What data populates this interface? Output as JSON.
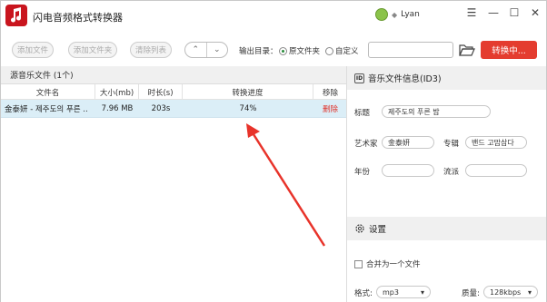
{
  "app": {
    "title": "闪电音频格式转换器"
  },
  "user": {
    "vip": "VIP",
    "name": "Lyan"
  },
  "window": {
    "minimize": "—",
    "restore": "☐",
    "close": "✕",
    "menu": "☰"
  },
  "toolbar": {
    "add_file": "添加文件",
    "add_folder": "添加文件夹",
    "clear_list": "清除列表",
    "up_arrow": "⌃",
    "down_arrow": "⌄",
    "output_dir_label": "输出目录：",
    "radio_source": "原文件夹",
    "radio_custom": "自定义",
    "output_path": "",
    "convert": "转换中..."
  },
  "source": {
    "header": "源音乐文件 (1个)",
    "columns": [
      "文件名",
      "大小(mb)",
      "时长(s)",
      "转换进度",
      "移除"
    ],
    "rows": [
      {
        "filename": "金泰妍 - 제주도의 푸른 ..",
        "size": "7.96 MB",
        "duration": "203s",
        "progress": "74%",
        "remove": "删除"
      }
    ]
  },
  "info": {
    "header": "音乐文件信息(ID3)",
    "title_label": "标题",
    "title_value": "제주도의 푸른 밤",
    "artist_label": "艺术家",
    "artist_value": "金泰妍",
    "album_label": "专辑",
    "album_value": "밴드 고맙삼다",
    "year_label": "年份",
    "year_value": "",
    "genre_label": "流派",
    "genre_value": ""
  },
  "settings": {
    "header": "设置",
    "merge_label": "合并为一个文件",
    "format_label": "格式:",
    "format_value": "mp3",
    "quality_label": "质量:",
    "quality_value": "128kbps"
  },
  "colors": {
    "accent": "#e43c2f",
    "row_highlight": "#dbeef7",
    "annotation_arrow": "#e8332a"
  }
}
